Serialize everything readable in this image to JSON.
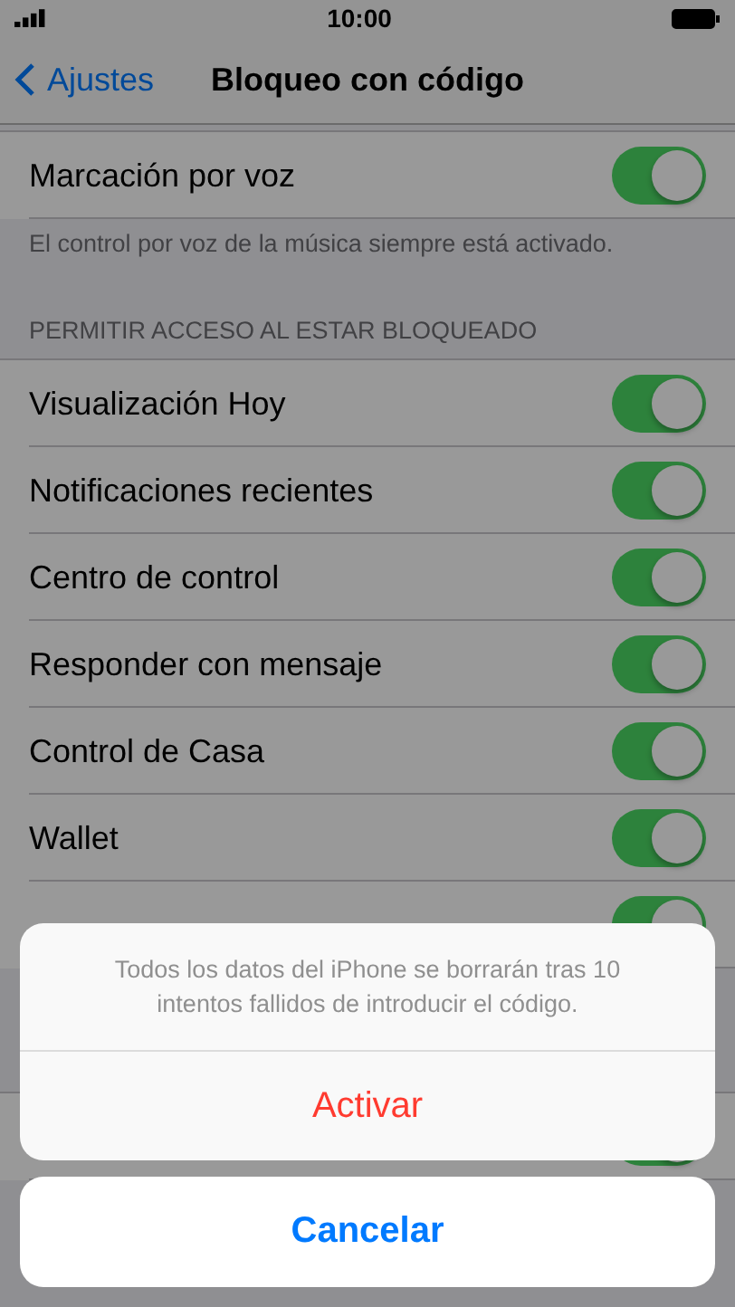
{
  "status_bar": {
    "time": "10:00"
  },
  "nav": {
    "back": "Ajustes",
    "title": "Bloqueo con código"
  },
  "voice": {
    "label": "Marcación por voz",
    "on": true,
    "footer": "El control por voz de la música siempre está activado."
  },
  "lock_access": {
    "header": "PERMITIR ACCESO AL ESTAR BLOQUEADO",
    "items": [
      {
        "label": "Visualización Hoy",
        "on": true
      },
      {
        "label": "Notificaciones recientes",
        "on": true
      },
      {
        "label": "Centro de control",
        "on": true
      },
      {
        "label": "Responder con mensaje",
        "on": true
      },
      {
        "label": "Control de Casa",
        "on": true
      },
      {
        "label": "Wallet",
        "on": true
      },
      {
        "on": true
      }
    ]
  },
  "erase": {
    "on": true
  },
  "action_sheet": {
    "message": "Todos los datos del iPhone se borrarán tras 10 intentos fallidos de introducir el código.",
    "action": "Activar",
    "cancel": "Cancelar"
  }
}
